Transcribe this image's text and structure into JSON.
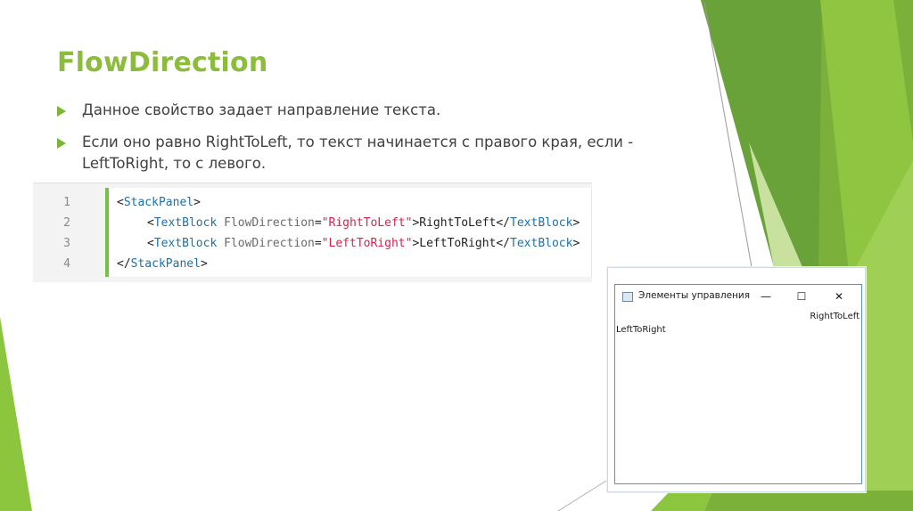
{
  "slide": {
    "title": "FlowDirection",
    "bullets": [
      "Данное свойство задает направление текста.",
      "Если оно равно RightToLeft, то текст начинается с правого края, если - LeftToRight, то с левого."
    ],
    "accent_color": "#8cbc3c"
  },
  "code": {
    "line_numbers": [
      "1",
      "2",
      "3",
      "4"
    ],
    "lines": [
      {
        "open": "<",
        "tag": "StackPanel",
        "close": ">"
      },
      {
        "open": "<",
        "tag": "TextBlock",
        "attr": "FlowDirection",
        "eq": "=",
        "value": "\"RightToLeft\"",
        "gt": ">",
        "text": "RightToLeft",
        "endopen": "</",
        "endtag": "TextBlock",
        "endclose": ">"
      },
      {
        "open": "<",
        "tag": "TextBlock",
        "attr": "FlowDirection",
        "eq": "=",
        "value": "\"LeftToRight\"",
        "gt": ">",
        "text": "LeftToRight",
        "endopen": "</",
        "endtag": "TextBlock",
        "endclose": ">"
      },
      {
        "open": "</",
        "tag": "StackPanel",
        "close": ">"
      }
    ]
  },
  "window": {
    "title": "Элементы управления",
    "minimize_glyph": "—",
    "maximize_glyph": "☐",
    "close_glyph": "✕",
    "rtl_text": "RightToLeft",
    "ltr_text": "LeftToRight",
    "app_icon": "window-app-icon",
    "border_color": "#5a8fd0"
  }
}
